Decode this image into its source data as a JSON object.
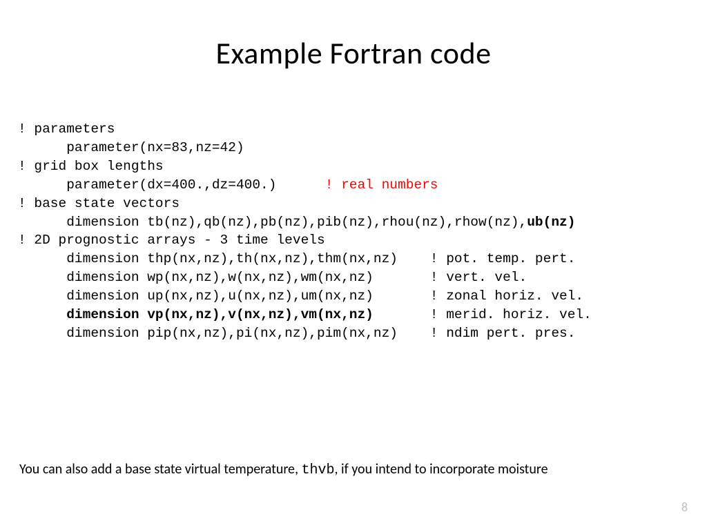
{
  "title": "Example Fortran code",
  "code": {
    "c1": "! parameters",
    "l1": "      parameter(nx=83,nz=42)",
    "c2": "! grid box lengths",
    "l2a": "      parameter(dx=400.,dz=400.)      ",
    "l2b": "! real numbers",
    "c3": "! base state vectors",
    "l3a": "      dimension tb(nz),qb(nz),pb(nz),pib(nz),rhou(nz),rhow(nz),",
    "l3b": "ub(nz)",
    "c4": "! 2D prognostic arrays - 3 time levels",
    "l4": "      dimension thp(nx,nz),th(nx,nz),thm(nx,nz)    ! pot. temp. pert.",
    "l5": "      dimension wp(nx,nz),w(nx,nz),wm(nx,nz)       ! vert. vel.",
    "l6": "      dimension up(nx,nz),u(nx,nz),um(nx,nz)       ! zonal horiz. vel.",
    "l7a": "      dimension vp(nx,nz),v(nx,nz),vm(nx,nz)",
    "l7b": "       ! merid. horiz. vel.",
    "l8": "      dimension pip(nx,nz),pi(nx,nz),pim(nx,nz)    ! ndim pert. pres."
  },
  "footer": {
    "pre": "You can also add a base state virtual temperature, ",
    "var": "thvb",
    "post": ", if you intend to incorporate moisture"
  },
  "page_number": "8"
}
